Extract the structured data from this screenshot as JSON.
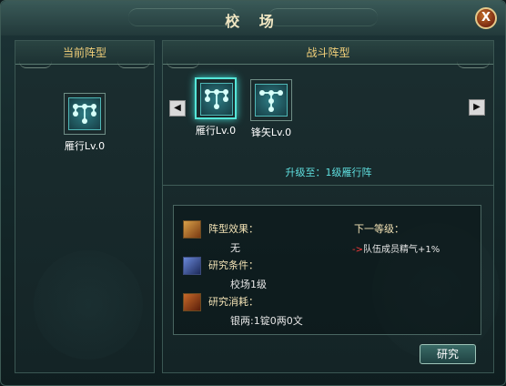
{
  "window": {
    "title": "校 场",
    "close_label": "X"
  },
  "left_panel": {
    "header": "当前阵型",
    "current_formation": {
      "label": "雁行Lv.0",
      "icon": "formation-icon"
    }
  },
  "right_panel": {
    "header": "战斗阵型",
    "prev_icon": "arrow-left-icon",
    "next_icon": "arrow-right-icon",
    "formations": [
      {
        "label": "雁行Lv.0",
        "selected": true,
        "icon": "formation-icon"
      },
      {
        "label": "锋矢Lv.0",
        "selected": false,
        "icon": "formation-icon"
      }
    ],
    "upgrade_text": "升级至：1级雁行阵"
  },
  "details": {
    "effect_label": "阵型效果：",
    "effect_value": "无",
    "condition_label": "研究条件：",
    "condition_value": "校场1级",
    "cost_label": "研究消耗：",
    "cost_value": "银两:1锭0两0文",
    "next_level_label": "下一等级：",
    "next_arrow": "->",
    "next_level_value": "队伍成员精气+1%"
  },
  "actions": {
    "research_label": "研究"
  },
  "colors": {
    "panel_header_text": "#f2d07a",
    "upgrade_text": "#5fe0e0",
    "selected_glow": "#55e6d8",
    "next_arrow": "#ff3a3a"
  }
}
